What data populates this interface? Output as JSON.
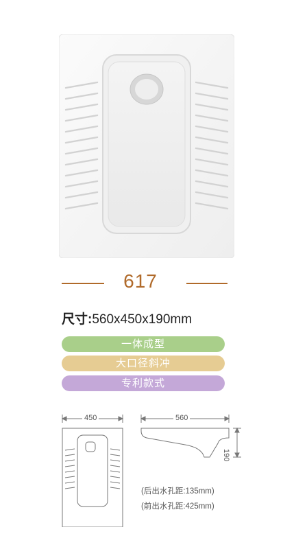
{
  "model": "617",
  "size": {
    "label": "尺寸:",
    "value": "560x450x190mm"
  },
  "features": [
    {
      "label": "一体成型",
      "color": "#a9cf8a"
    },
    {
      "label": "大口径斜冲",
      "color": "#e6cc93"
    },
    {
      "label": "专利款式",
      "color": "#c4a8d8"
    }
  ],
  "dims": {
    "top_width": "450",
    "side_length": "560",
    "height": "190"
  },
  "notes": {
    "rear": "(后出水孔距:135mm)",
    "front": "(前出水孔距:425mm)"
  },
  "colors": {
    "accent": "#b06a2a"
  }
}
